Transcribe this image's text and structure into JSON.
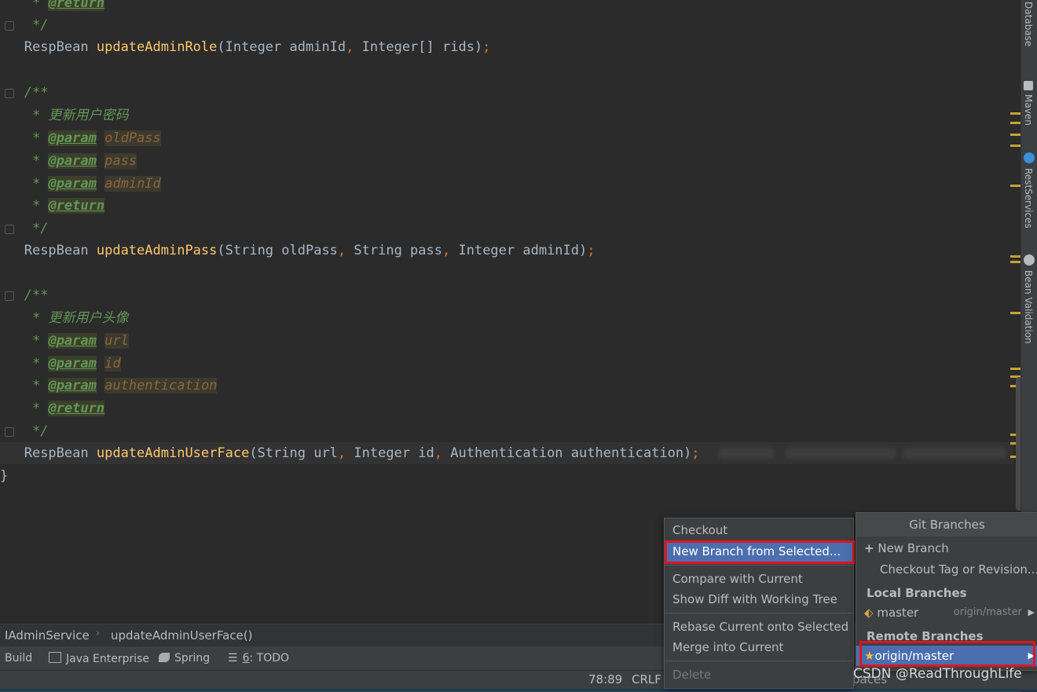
{
  "editor": {
    "l0_tag": "@return",
    "l1_close": "*/",
    "l2_ret": "RespBean",
    "l2_fn": "updateAdminRole",
    "l2_args_a": "(Integer adminId",
    "l2_comma": ",",
    "l2_args_b": " Integer[] rids)",
    "l2_semi": ";",
    "doc_open": "/**",
    "c2_title": "更新用户密码",
    "param_tag": "@param",
    "return_tag": "@return",
    "c2_p1": "oldPass",
    "c2_p2": "pass",
    "c2_p3": "adminId",
    "l10_ret": "RespBean",
    "l10_fn": "updateAdminPass",
    "l10_a": "(String oldPass",
    "l10_b": " String pass",
    "l10_c": " Integer adminId)",
    "c3_title": "更新用户头像",
    "c3_p1": "url",
    "c3_p2": "id",
    "c3_p3": "authentication",
    "l19_ret": "RespBean",
    "l19_fn": "updateAdminUserFace",
    "l19_a": "(String url",
    "l19_b": " Integer id",
    "l19_c": " Authentication authentication)",
    "close_brace": "}",
    "star": "*"
  },
  "right_tools": [
    "Database",
    "Maven",
    "RestServices",
    "Bean Validation"
  ],
  "breadcrumb": [
    "IAdminService",
    "updateAdminUserFace()"
  ],
  "toolbar": {
    "build": "Build",
    "java_enterprise": "Java Enterprise",
    "spring": "Spring",
    "todo_num": "6",
    "todo_label": ": TODO"
  },
  "status": {
    "position": "78:89",
    "line_sep": "CRLF",
    "trailing": "paces"
  },
  "context_menu": {
    "checkout": "Checkout",
    "new_branch_from_selected": "New Branch from Selected...",
    "compare_with_current": "Compare with Current",
    "show_diff": "Show Diff with Working Tree",
    "rebase": "Rebase Current onto Selected",
    "merge": "Merge into Current",
    "delete": "Delete"
  },
  "git_branches": {
    "title": "Git Branches",
    "new_branch": "New Branch",
    "checkout_tag": "Checkout Tag or Revision...",
    "local_header": "Local Branches",
    "local_master": "master",
    "local_master_tracking": "origin/master",
    "remote_header": "Remote Branches",
    "remote_origin_master": "origin/master"
  },
  "watermark": "CSDN @ReadThroughLife",
  "colors": {
    "editor_bg": "#2b2b2b",
    "comment": "#629755",
    "function": "#ffc66d",
    "punctuation": "#cc7832",
    "selection": "#4b6eaf",
    "highlight_box": "#e0161e"
  }
}
